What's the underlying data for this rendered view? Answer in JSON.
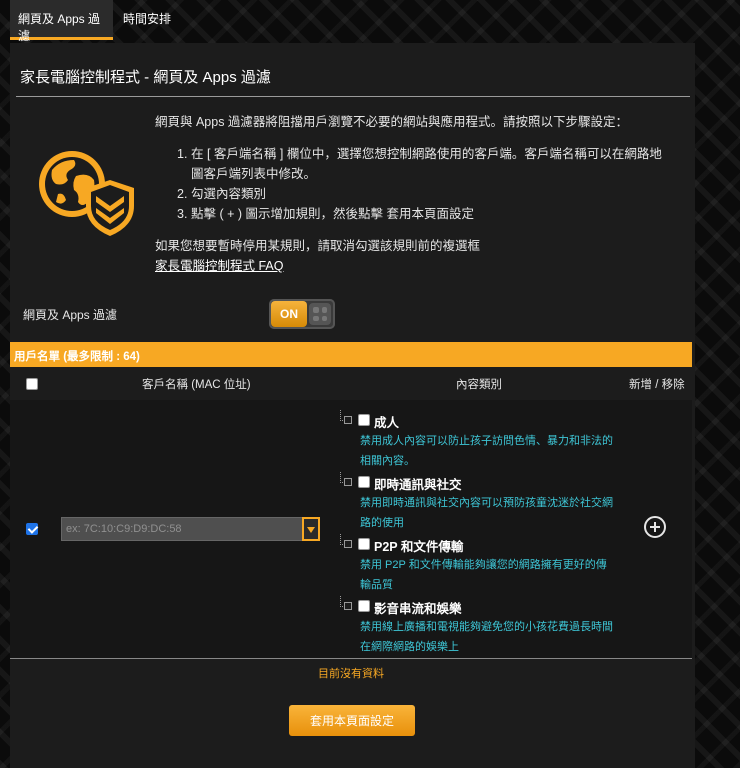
{
  "tabs": [
    {
      "label": "網頁及 Apps 過濾",
      "active": true
    },
    {
      "label": "時間安排",
      "active": false
    }
  ],
  "page": {
    "title": "家長電腦控制程式 - 網頁及 Apps 過濾",
    "intro": "網頁與 Apps 過濾器將阻擋用戶瀏覽不必要的網站與應用程式。請按照以下步驟設定：",
    "steps": [
      {
        "num": "1.",
        "text": "在 [ 客戶端名稱 ] 欄位中，選擇您想控制網路使用的客戶端。客戶端名稱可以在網路地圖客戶端列表中修改。"
      },
      {
        "num": "2.",
        "text": "勾選內容類別"
      },
      {
        "num": "3.",
        "text": "點擊 ( + ) 圖示增加規則，然後點擊 套用本頁面設定"
      }
    ],
    "note": "如果您想要暫時停用某規則，請取消勾選該規則前的複選框",
    "faq_link": "家長電腦控制程式 FAQ"
  },
  "filter_toggle": {
    "label": "網頁及 Apps 過濾",
    "state": "ON"
  },
  "client_list": {
    "header": "用戶名單 (最多限制 : 64)",
    "col_client": "客戶名稱 (MAC 位址)",
    "col_content": "內容類別",
    "col_action": "新增 / 移除",
    "mac_placeholder": "ex: 7C:10:C9:D9:DC:58",
    "row_checked": true,
    "categories": [
      {
        "name": "成人",
        "desc": "禁用成人內容可以防止孩子訪問色情、暴力和非法的相關內容。"
      },
      {
        "name": "即時通訊與社交",
        "desc": "禁用即時通訊與社交內容可以預防孩童沈迷於社交網路的使用"
      },
      {
        "name": "P2P 和文件傳輸",
        "desc": "禁用 P2P 和文件傳輸能夠讓您的網路擁有更好的傳輸品質"
      },
      {
        "name": "影音串流和娛樂",
        "desc": "禁用線上廣播和電視能夠避免您的小孩花費過長時間在網際網路的娛樂上"
      }
    ],
    "no_data": "目前沒有資料"
  },
  "apply_button": "套用本頁面設定",
  "colors": {
    "accent": "#f7a823",
    "desc_text": "#3ec6d6",
    "panel": "#1c1c1c"
  },
  "icons": [
    "globe-icon",
    "shield-icon",
    "chevron-down-icon",
    "add-circle-icon"
  ]
}
